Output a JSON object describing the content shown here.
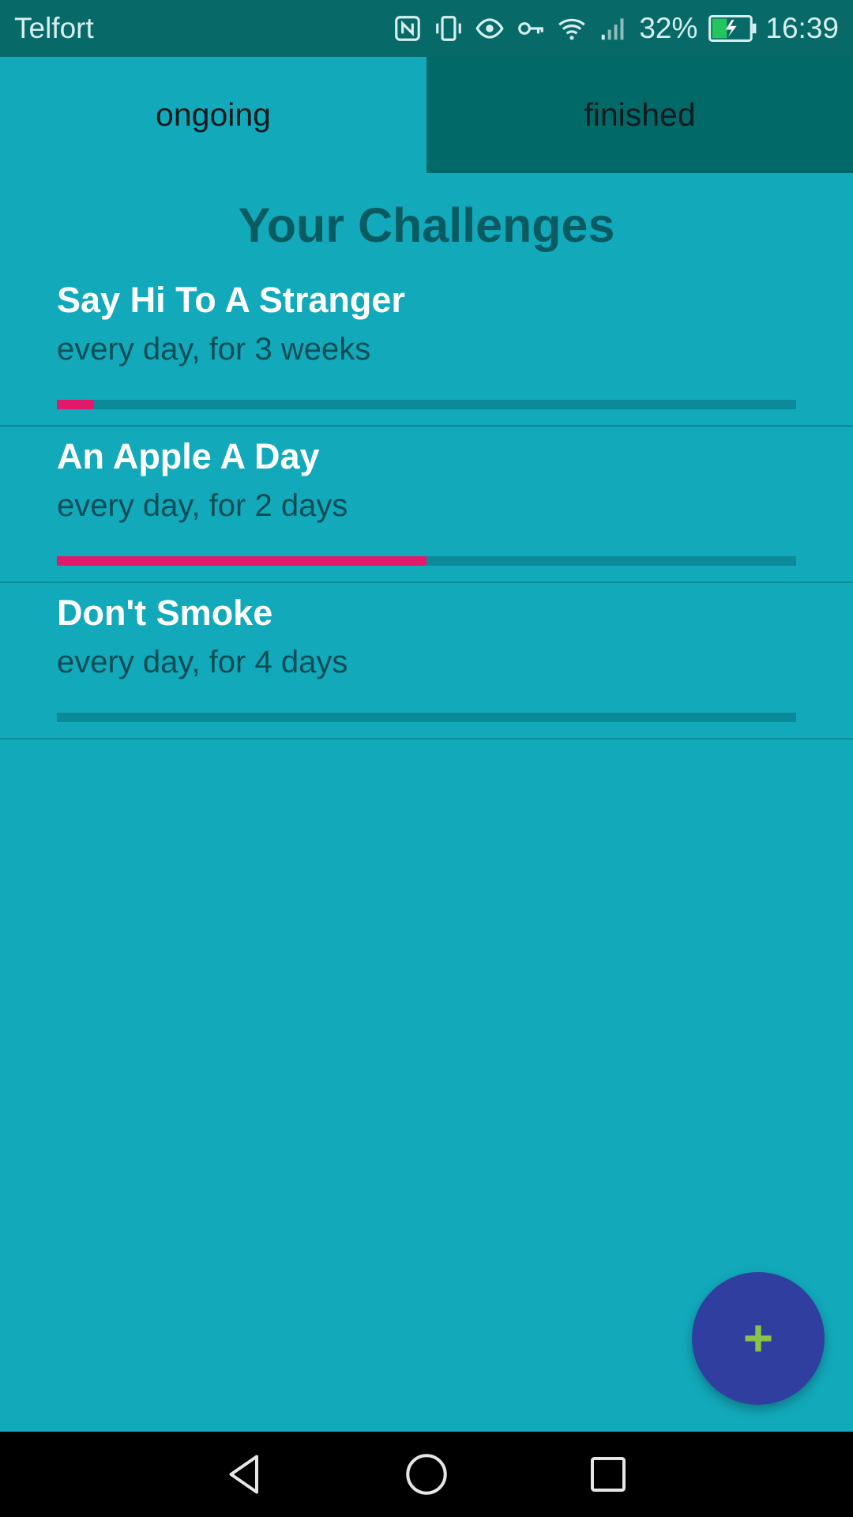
{
  "status_bar": {
    "carrier": "Telfort",
    "battery_percent": "32%",
    "time": "16:39",
    "icons": [
      "nfc-icon",
      "vibrate-icon",
      "eye-icon",
      "key-icon",
      "wifi-icon",
      "signal-icon",
      "battery-charging-icon"
    ]
  },
  "tabs": [
    {
      "label": "ongoing",
      "active": true
    },
    {
      "label": "finished",
      "active": false
    }
  ],
  "page": {
    "title": "Your Challenges"
  },
  "challenges": [
    {
      "title": "Say Hi To A Stranger",
      "subtitle": "every day, for 3 weeks",
      "progress": 0.05
    },
    {
      "title": "An Apple A Day",
      "subtitle": "every day, for 2 days",
      "progress": 0.5
    },
    {
      "title": "Don't Smoke",
      "subtitle": "every day, for 4 days",
      "progress": 0.0
    }
  ],
  "fab": {
    "icon": "plus-icon"
  },
  "colors": {
    "background": "#12a9bb",
    "status_bar": "#086a68",
    "tab_inactive": "#016968",
    "title": "#0a5a62",
    "progress_fill": "#e0196a",
    "fab": "#303f9f",
    "fab_icon": "#8bc34a"
  },
  "nav_bar": {
    "buttons": [
      "back-icon",
      "home-icon",
      "recents-icon"
    ]
  }
}
